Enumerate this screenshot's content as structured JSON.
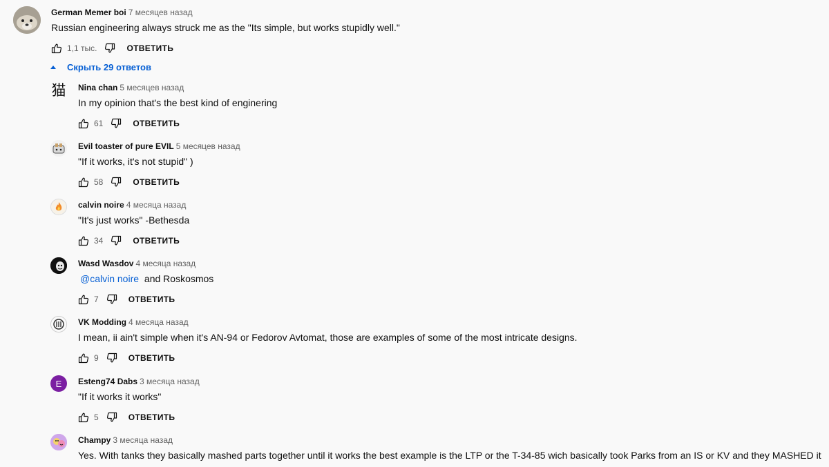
{
  "comments": [
    {
      "author": "German Memer boi",
      "time": "7 месяцев назад",
      "text": "Russian engineering always struck me as the \"Its simple, but works stupidly well.\"",
      "likes": "1,1 тыс.",
      "reply": "ОТВЕТИТЬ",
      "avatar": "dog-avatar"
    },
    {
      "author": "Nina chan",
      "time": "5 месяцев назад",
      "text": "In my opinion that's the best kind of enginering",
      "likes": "61",
      "reply": "ОТВЕТИТЬ",
      "avatar_glyph": "猫"
    },
    {
      "author": "Evil toaster of pure EVIL",
      "time": "5 месяцев назад",
      "text": "\"If it works, it's not stupid\" )",
      "likes": "58",
      "reply": "ОТВЕТИТЬ",
      "avatar": "toaster-avatar"
    },
    {
      "author": "calvin noire",
      "time": "4 месяца назад",
      "text": "\"It's just works\" -Bethesda",
      "likes": "34",
      "reply": "ОТВЕТИТЬ",
      "avatar": "flame-avatar"
    },
    {
      "author": "Wasd Wasdov",
      "time": "4 месяца назад",
      "mention": "@calvin noire",
      "text": " and Roskosmos",
      "likes": "7",
      "reply": "ОТВЕТИТЬ",
      "avatar": "face-avatar"
    },
    {
      "author": "VK Modding",
      "time": "4 месяца назад",
      "text": "I mean, ii ain't simple when it's AN-94 or Fedorov Avtomat, those are examples of some of the most intricate designs.",
      "likes": "9",
      "reply": "ОТВЕТИТЬ",
      "avatar": "logo-avatar"
    },
    {
      "author": "Esteng74 Dabs",
      "time": "3 месяца назад",
      "text": "\"If it works it works\"",
      "likes": "5",
      "reply": "ОТВЕТИТЬ",
      "avatar_letter": "E"
    },
    {
      "author": "Champy",
      "time": "3 месяца назад",
      "text": "Yes. With tanks they basically mashed parts together until it works the best example is the LTP or the T-34-85 wich basically took Parks from an IS or KV and they MASHED it",
      "avatar": "cartoon-avatar"
    }
  ],
  "replies_toggle": "Скрыть 29 ответов",
  "colors": {
    "accent": "#065fd4",
    "esteng_avatar": "#7b1fa2",
    "background": "#f9f9f9"
  }
}
